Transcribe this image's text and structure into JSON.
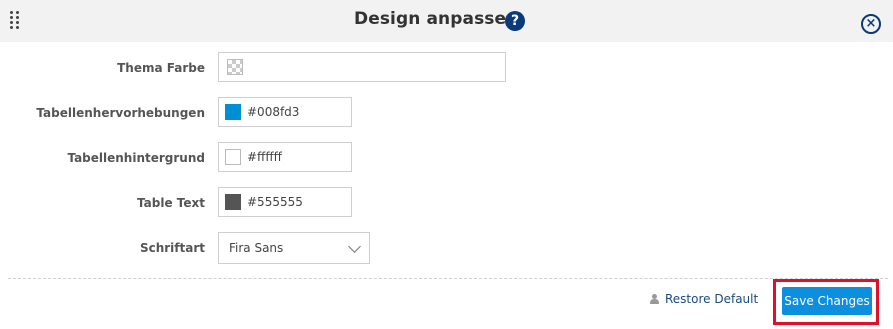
{
  "dialog": {
    "title": "Design anpassen",
    "accent_color": "#0a3a7a"
  },
  "fields": {
    "theme_color": {
      "label": "Thema Farbe",
      "value": ""
    },
    "table_highlight": {
      "label": "Tabellenhervorhebungen",
      "value": "#008fd3",
      "swatch": "#008fd3"
    },
    "table_background": {
      "label": "Tabellenhintergrund",
      "value": "#ffffff",
      "swatch": "#ffffff"
    },
    "table_text": {
      "label": "Table Text",
      "value": "#555555",
      "swatch": "#555555"
    },
    "font": {
      "label": "Schriftart",
      "selected": "Fira Sans"
    }
  },
  "footer": {
    "restore_label": "Restore Default",
    "save_label": "Save Changes",
    "save_color": "#0c8fde",
    "highlight_color": "#e0102b"
  },
  "icons": {
    "drag": "drag-handle-icon",
    "help": "question-circle-icon",
    "close": "close-circle-icon",
    "user": "user-icon",
    "chevron": "chevron-down-icon"
  }
}
